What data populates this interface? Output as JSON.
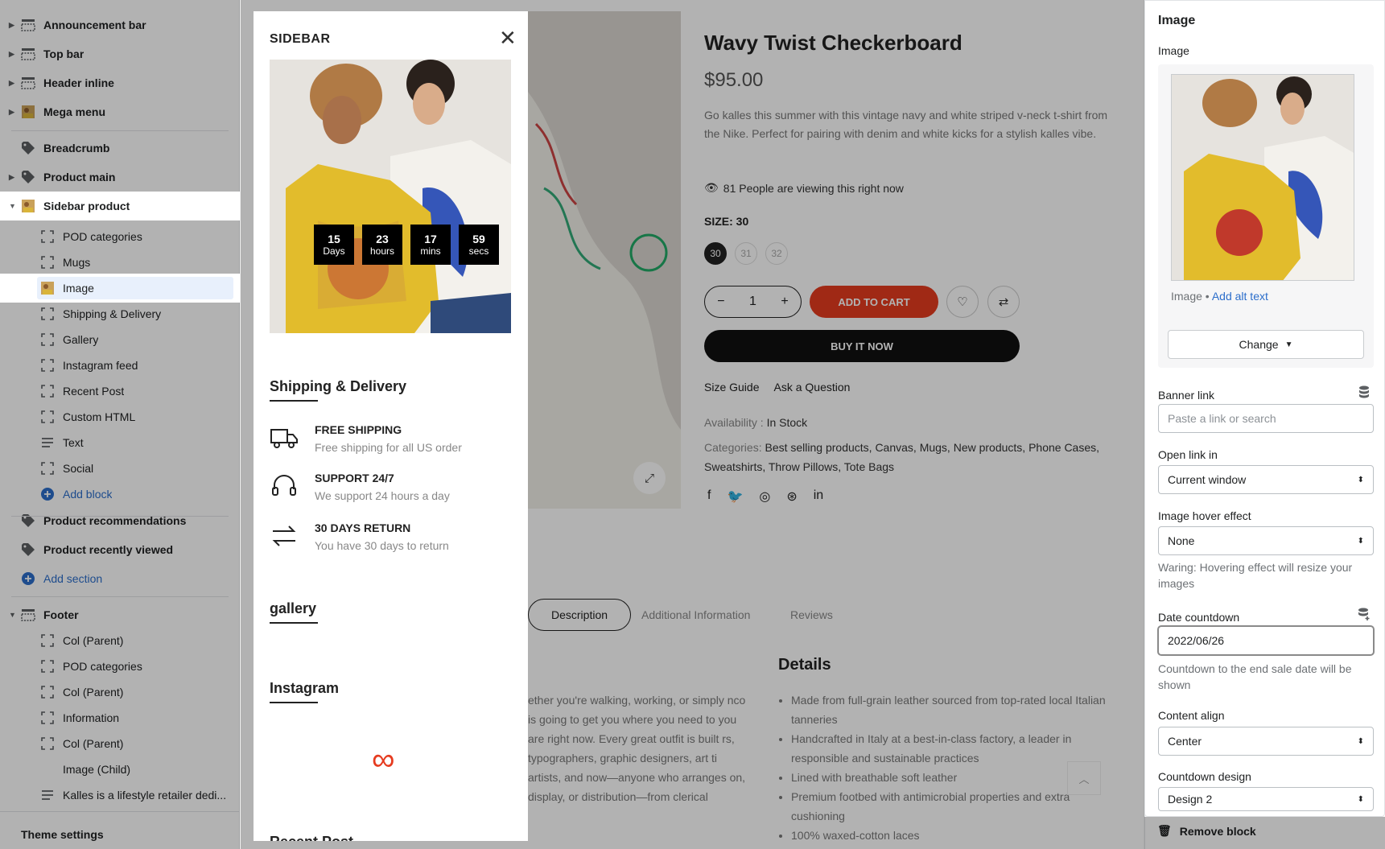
{
  "left_tree": {
    "items": [
      {
        "label": "Announcement bar",
        "icon": "section-layout-icon",
        "level": 0,
        "caret": true
      },
      {
        "label": "Top bar",
        "icon": "section-layout-icon",
        "level": 0,
        "caret": true
      },
      {
        "label": "Header inline",
        "icon": "section-layout-icon",
        "level": 0,
        "caret": true
      },
      {
        "label": "Mega menu",
        "icon": "image-thumb-icon",
        "level": 0,
        "caret": true
      },
      {
        "label": "Breadcrumb",
        "icon": "tag-icon",
        "level": 0,
        "caret": false
      },
      {
        "label": "Product main",
        "icon": "tag-icon",
        "level": 0,
        "caret": true
      },
      {
        "label": "Sidebar product",
        "icon": "image-thumb-icon",
        "level": 0,
        "caret": true,
        "expanded": true
      },
      {
        "label": "POD categories",
        "icon": "block-icon",
        "level": 1
      },
      {
        "label": "Mugs",
        "icon": "block-icon",
        "level": 1
      },
      {
        "label": "Image",
        "icon": "image-thumb-icon",
        "level": 1,
        "selected": true
      },
      {
        "label": "Shipping & Delivery",
        "icon": "block-icon",
        "level": 1
      },
      {
        "label": "Gallery",
        "icon": "block-icon",
        "level": 1
      },
      {
        "label": "Instagram feed",
        "icon": "block-icon",
        "level": 1
      },
      {
        "label": "Recent Post",
        "icon": "block-icon",
        "level": 1
      },
      {
        "label": "Custom HTML",
        "icon": "block-icon",
        "level": 1
      },
      {
        "label": "Text",
        "icon": "text-lines-icon",
        "level": 1
      },
      {
        "label": "Social",
        "icon": "block-icon",
        "level": 1
      },
      {
        "label": "Add block",
        "icon": "plus-circle-icon",
        "level": 1,
        "add": true
      },
      {
        "label": "Product recommendations",
        "icon": "tag-icon",
        "level": 0
      },
      {
        "label": "Product recently viewed",
        "icon": "tag-icon",
        "level": 0
      },
      {
        "label": "Add section",
        "icon": "plus-circle-icon",
        "level": 0,
        "add": true
      },
      {
        "label": "Footer",
        "icon": "section-layout-icon",
        "level": 0,
        "caret": true,
        "expanded": true
      },
      {
        "label": "Col (Parent)",
        "icon": "block-icon",
        "level": 1
      },
      {
        "label": "POD categories",
        "icon": "block-icon",
        "level": 1
      },
      {
        "label": "Col (Parent)",
        "icon": "block-icon",
        "level": 1
      },
      {
        "label": "Information",
        "icon": "block-icon",
        "level": 1
      },
      {
        "label": "Col (Parent)",
        "icon": "block-icon",
        "level": 1
      },
      {
        "label": "Image (Child)",
        "icon": "",
        "level": 1
      },
      {
        "label": "Kalles is a lifestyle retailer dedi...",
        "icon": "text-lines-icon",
        "level": 1
      }
    ],
    "theme_settings": "Theme settings"
  },
  "drawer": {
    "title": "SIDEBAR",
    "countdown": [
      {
        "n": "15",
        "u": "Days"
      },
      {
        "n": "23",
        "u": "hours"
      },
      {
        "n": "17",
        "u": "mins"
      },
      {
        "n": "59",
        "u": "secs"
      }
    ],
    "shipping_title": "Shipping & Delivery",
    "services": [
      {
        "icon": "truck-icon",
        "title": "FREE SHIPPING",
        "sub": "Free shipping for all US order"
      },
      {
        "icon": "headset-icon",
        "title": "SUPPORT 24/7",
        "sub": "We support 24 hours a day"
      },
      {
        "icon": "arrows-exchange-icon",
        "title": "30 DAYS RETURN",
        "sub": "You have 30 days to return"
      }
    ],
    "gallery_title": "gallery",
    "instagram_title": "Instagram",
    "recent_title": "Recent Post"
  },
  "product": {
    "title": "Wavy Twist Checkerboard",
    "price": "$95.00",
    "description": "Go kalles this summer with this vintage navy and white striped v-neck t-shirt from the Nike. Perfect for pairing with denim and white kicks for a stylish kalles vibe.",
    "viewing": "81 People are viewing this right now",
    "size_label": "SIZE: 30",
    "sizes": [
      "30",
      "31",
      "32"
    ],
    "qty": "1",
    "add_to_cart": "ADD TO CART",
    "buy_now": "BUY IT NOW",
    "size_guide": "Size Guide",
    "ask": "Ask a Question",
    "availability_label": "Availability :",
    "availability": "In Stock",
    "categories_label": "Categories:",
    "categories": "Best selling products, Canvas, Mugs, New products, Phone Cases, Sweatshirts, Throw Pillows, Tote Bags",
    "tabs": [
      "Description",
      "Additional Information",
      "Reviews"
    ],
    "details_title": "Details",
    "details": [
      "Made from full-grain leather sourced from top-rated local Italian tanneries",
      "Handcrafted in Italy at a best-in-class factory, a leader in responsible and sustainable practices",
      "Lined with breathable soft leather",
      "Premium footbed with antimicrobial properties and extra cushioning",
      "100% waxed-cotton laces"
    ],
    "desc_body": "ether you're walking, working, or simply nco is going to get you where you need to you are right now. Every great outfit is built rs, typographers, graphic designers, art ti artists, and now—anyone who arranges on, display, or distribution—from clerical"
  },
  "right_panel": {
    "title": "Image",
    "image_label": "Image",
    "alt_prefix": "Image •",
    "alt_link": "Add alt text",
    "change": "Change",
    "banner_link_label": "Banner link",
    "banner_link_placeholder": "Paste a link or search",
    "open_link_label": "Open link in",
    "open_link_value": "Current window",
    "hover_label": "Image hover effect",
    "hover_value": "None",
    "hover_help": "Waring: Hovering effect will resize your images",
    "date_label": "Date countdown",
    "date_value": "2022/06/26",
    "date_help": "Countdown to the end sale date will be shown",
    "align_label": "Content align",
    "align_value": "Center",
    "design_label": "Countdown design",
    "design_value": "Design 2",
    "remove": "Remove block"
  },
  "colors": {
    "accent": "#2c6ecb",
    "cart": "#e63b1f"
  }
}
